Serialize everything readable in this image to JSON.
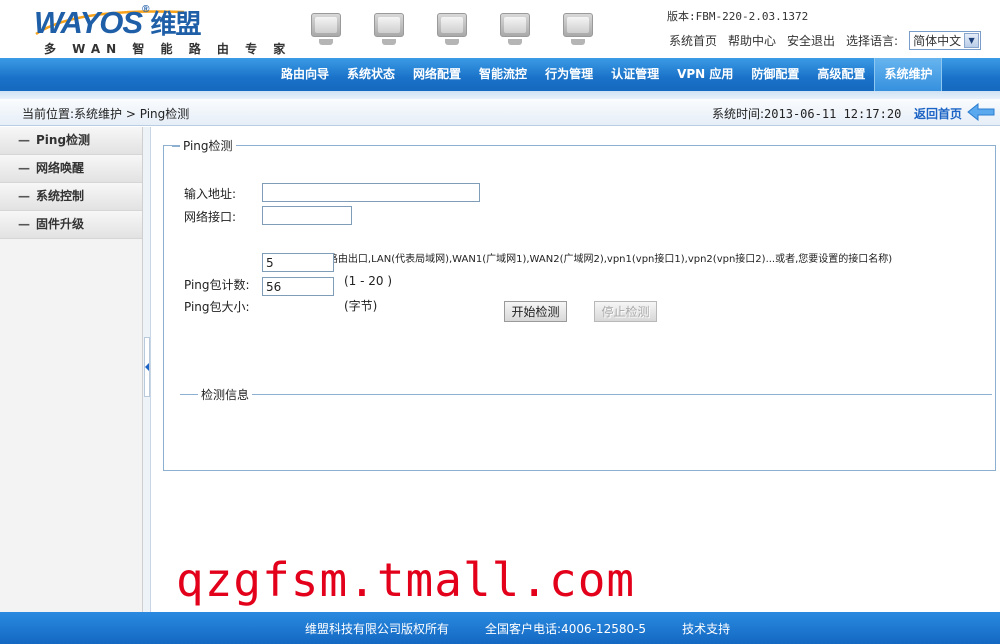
{
  "header": {
    "logo_main": "WAYOS",
    "logo_cn": "维盟",
    "logo_sub": "多 WAN 智 能 路 由 专 家",
    "version": "版本:FBM-220-2.03.1372",
    "links": {
      "home": "系统首页",
      "help": "帮助中心",
      "logout": "安全退出",
      "lang_label": "选择语言:"
    },
    "language_selected": "简体中文"
  },
  "nav": {
    "items": [
      {
        "label": "路由向导"
      },
      {
        "label": "系统状态"
      },
      {
        "label": "网络配置"
      },
      {
        "label": "智能流控"
      },
      {
        "label": "行为管理"
      },
      {
        "label": "认证管理"
      },
      {
        "label": "VPN 应用"
      },
      {
        "label": "防御配置"
      },
      {
        "label": "高级配置"
      },
      {
        "label": "系统维护"
      }
    ],
    "active_index": 9
  },
  "breadcrumb": {
    "text": "当前位置:系统维护 > Ping检测",
    "systime_label": "系统时间:",
    "systime_value": "2013-06-11 12:17:20",
    "home_link": "返回首页"
  },
  "sidebar": {
    "items": [
      {
        "label": "Ping检测"
      },
      {
        "label": "网络唤醒"
      },
      {
        "label": "系统控制"
      },
      {
        "label": "固件升级"
      }
    ]
  },
  "form": {
    "legend": "Ping检测",
    "address_label": "输入地址:",
    "address_value": "",
    "iface_label": "网络接口:",
    "iface_value": "",
    "iface_hint": "(为空表示默认路由出口,LAN(代表局域网),WAN1(广域网1),WAN2(广域网2),vpn1(vpn接口1),vpn2(vpn接口2)...或者,您要设置的接口名称)",
    "count_label": "Ping包计数:",
    "count_value": "5",
    "count_range": "(1 - 20 )",
    "size_label": "Ping包大小:",
    "size_value": "56",
    "size_unit": "(字节)",
    "start_button": "开始检测",
    "stop_button": "停止检测",
    "info_legend": "检测信息"
  },
  "watermark": "qzgfsm.tmall.com",
  "footer": {
    "copyright": "维盟科技有限公司版权所有",
    "phone": "全国客户电话:4006-12580-5",
    "support": "技术支持"
  },
  "colors": {
    "nav_blue": "#1a72c8",
    "link_blue": "#1b63c4",
    "watermark_red": "#e3001b",
    "panel_border": "#8db0d2"
  }
}
